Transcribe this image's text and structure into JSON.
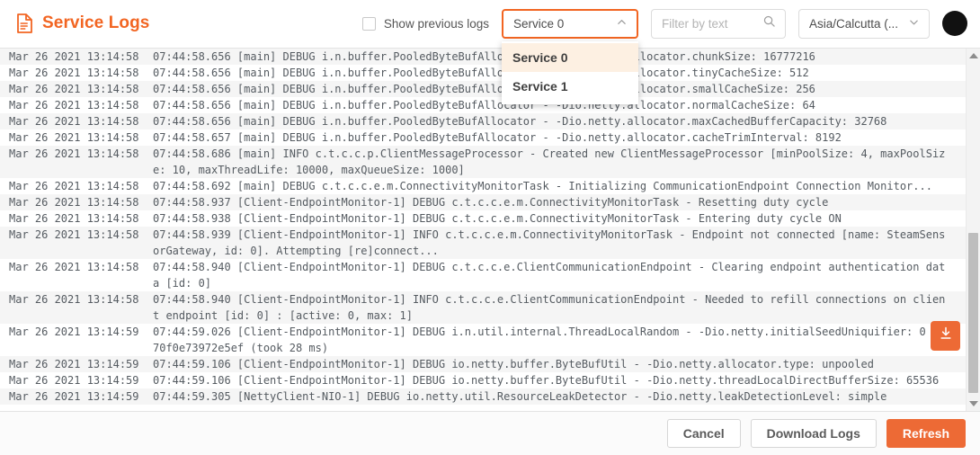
{
  "header": {
    "title": "Service Logs",
    "doc_icon": "document-icon",
    "accent_color": "#f26522",
    "checkbox": {
      "label": "Show previous logs",
      "checked": false
    },
    "service_select": {
      "value": "Service 0",
      "icon": "chevron-up-icon",
      "open": true
    },
    "filter": {
      "value": "",
      "placeholder": "Filter by text",
      "icon": "search-icon"
    },
    "timezone_select": {
      "value": "Asia/Calcutta (...",
      "icon": "chevron-down-icon"
    },
    "theme_toggle": {
      "icon": "moon-icon",
      "background": "#111111"
    }
  },
  "dropdown": {
    "options": [
      {
        "label": "Service 0",
        "selected": true
      },
      {
        "label": "Service 1",
        "selected": false
      }
    ]
  },
  "log": {
    "scroll_to_bottom": {
      "icon": "scroll-to-bottom-icon",
      "color": "#ed6a35"
    },
    "scrollbar": {
      "up_icon": "caret-up-icon",
      "down_icon": "caret-down-icon"
    },
    "rows": [
      {
        "timestamp": "Mar 26 2021 13:14:58",
        "message": "07:44:58.656 [main] DEBUG i.n.buffer.PooledByteBufAllocator - -Dio.netty.allocator.chunkSize: 16777216"
      },
      {
        "timestamp": "Mar 26 2021 13:14:58",
        "message": "07:44:58.656 [main] DEBUG i.n.buffer.PooledByteBufAllocator - -Dio.netty.allocator.tinyCacheSize: 512"
      },
      {
        "timestamp": "Mar 26 2021 13:14:58",
        "message": "07:44:58.656 [main] DEBUG i.n.buffer.PooledByteBufAllocator - -Dio.netty.allocator.smallCacheSize: 256"
      },
      {
        "timestamp": "Mar 26 2021 13:14:58",
        "message": "07:44:58.656 [main] DEBUG i.n.buffer.PooledByteBufAllocator - -Dio.netty.allocator.normalCacheSize: 64"
      },
      {
        "timestamp": "Mar 26 2021 13:14:58",
        "message": "07:44:58.656 [main] DEBUG i.n.buffer.PooledByteBufAllocator - -Dio.netty.allocator.maxCachedBufferCapacity: 32768"
      },
      {
        "timestamp": "Mar 26 2021 13:14:58",
        "message": "07:44:58.657 [main] DEBUG i.n.buffer.PooledByteBufAllocator - -Dio.netty.allocator.cacheTrimInterval: 8192"
      },
      {
        "timestamp": "Mar 26 2021 13:14:58",
        "message": "07:44:58.686 [main] INFO c.t.c.c.p.ClientMessageProcessor - Created new ClientMessageProcessor [minPoolSize: 4, maxPoolSiz",
        "continuation": "e: 10, maxThreadLife: 10000, maxQueueSize: 1000]"
      },
      {
        "timestamp": "Mar 26 2021 13:14:58",
        "message": "07:44:58.692 [main] DEBUG c.t.c.c.e.m.ConnectivityMonitorTask - Initializing CommunicationEndpoint Connection Monitor..."
      },
      {
        "timestamp": "Mar 26 2021 13:14:58",
        "message": "07:44:58.937 [Client-EndpointMonitor-1] DEBUG c.t.c.c.e.m.ConnectivityMonitorTask - Resetting duty cycle"
      },
      {
        "timestamp": "Mar 26 2021 13:14:58",
        "message": "07:44:58.938 [Client-EndpointMonitor-1] DEBUG c.t.c.c.e.m.ConnectivityMonitorTask - Entering duty cycle ON"
      },
      {
        "timestamp": "Mar 26 2021 13:14:58",
        "message": "07:44:58.939 [Client-EndpointMonitor-1] INFO c.t.c.c.e.m.ConnectivityMonitorTask - Endpoint not connected [name: SteamSens",
        "continuation": "orGateway, id: 0]. Attempting [re]connect..."
      },
      {
        "timestamp": "Mar 26 2021 13:14:58",
        "message": "07:44:58.940 [Client-EndpointMonitor-1] DEBUG c.t.c.c.e.ClientCommunicationEndpoint - Clearing endpoint authentication dat",
        "continuation": "a [id: 0]"
      },
      {
        "timestamp": "Mar 26 2021 13:14:58",
        "message": "07:44:58.940 [Client-EndpointMonitor-1] INFO c.t.c.c.e.ClientCommunicationEndpoint - Needed to refill connections on clien",
        "continuation": "t endpoint [id: 0] : [active: 0, max: 1]"
      },
      {
        "timestamp": "Mar 26 2021 13:14:59",
        "message": "07:44:59.026 [Client-EndpointMonitor-1] DEBUG i.n.util.internal.ThreadLocalRandom - -Dio.netty.initialSeedUniquifier: 0",
        "continuation": "70f0e73972e5ef (took 28 ms)"
      },
      {
        "timestamp": "Mar 26 2021 13:14:59",
        "message": "07:44:59.106 [Client-EndpointMonitor-1] DEBUG io.netty.buffer.ByteBufUtil - -Dio.netty.allocator.type: unpooled"
      },
      {
        "timestamp": "Mar 26 2021 13:14:59",
        "message": "07:44:59.106 [Client-EndpointMonitor-1] DEBUG io.netty.buffer.ByteBufUtil - -Dio.netty.threadLocalDirectBufferSize: 65536"
      },
      {
        "timestamp": "Mar 26 2021 13:14:59",
        "message": "07:44:59.305 [NettyClient-NIO-1] DEBUG io.netty.util.ResourceLeakDetector - -Dio.netty.leakDetectionLevel: simple"
      }
    ]
  },
  "footer": {
    "cancel_label": "Cancel",
    "download_label": "Download Logs",
    "refresh_label": "Refresh",
    "primary_color": "#ed6a35"
  }
}
